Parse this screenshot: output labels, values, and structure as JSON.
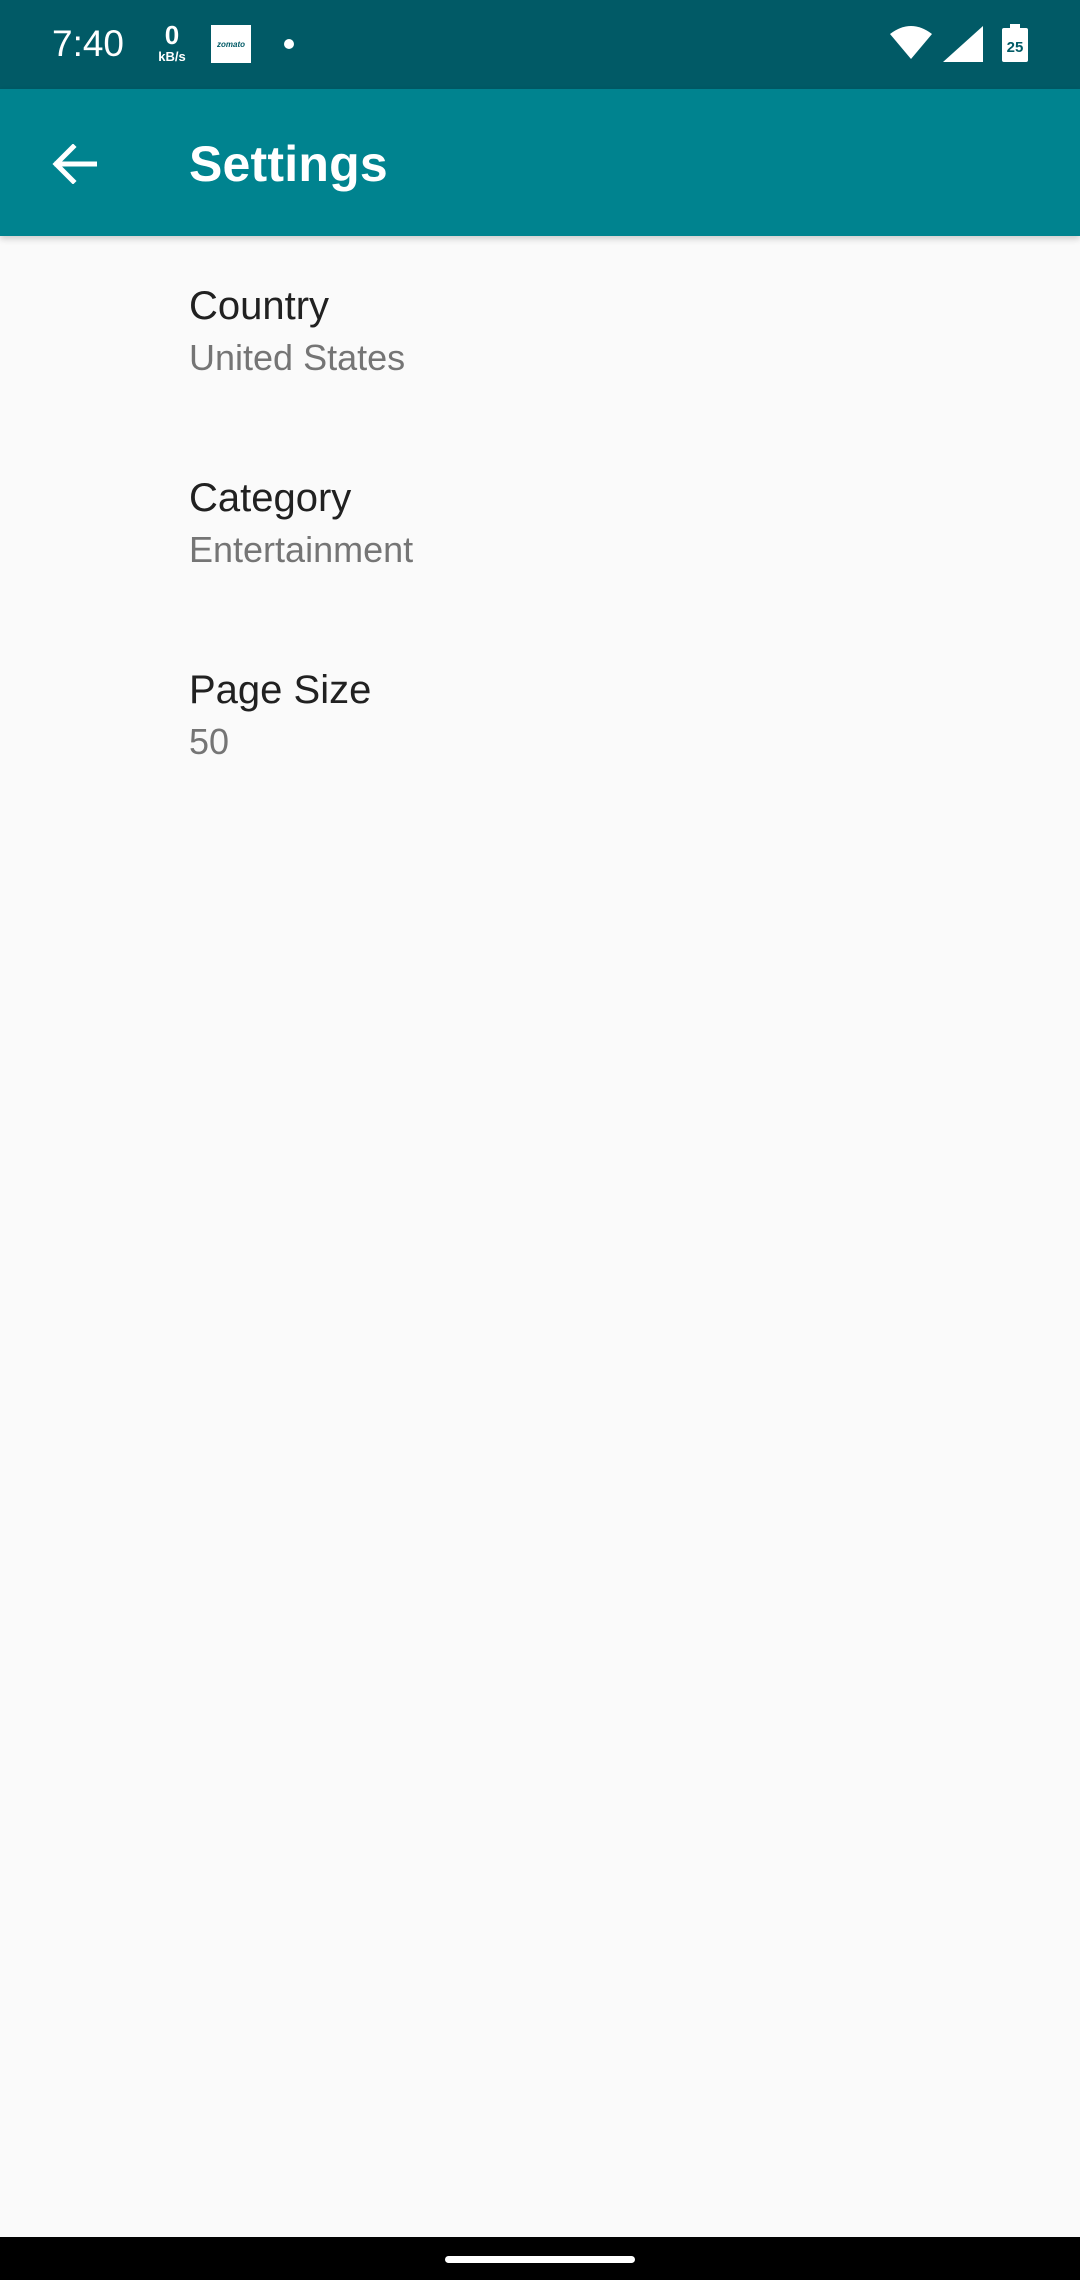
{
  "status_bar": {
    "time": "7:40",
    "net_speed_value": "0",
    "net_speed_unit": "kB/s",
    "zomato_label": "zomato",
    "battery_level": "25",
    "icons": [
      "zomato-app-icon",
      "notification-dot-icon",
      "wifi-icon",
      "cell-signal-icon",
      "battery-icon"
    ]
  },
  "app_bar": {
    "title": "Settings",
    "back_icon": "arrow-left-icon",
    "background": "#00838f"
  },
  "preferences": [
    {
      "title": "Country",
      "summary": "United States"
    },
    {
      "title": "Category",
      "summary": "Entertainment"
    },
    {
      "title": "Page Size",
      "summary": "50"
    }
  ],
  "colors": {
    "status_bar": "#015a66",
    "app_bar": "#00838f",
    "background": "#fafafa",
    "title_text": "#212121",
    "summary_text": "#757575"
  }
}
